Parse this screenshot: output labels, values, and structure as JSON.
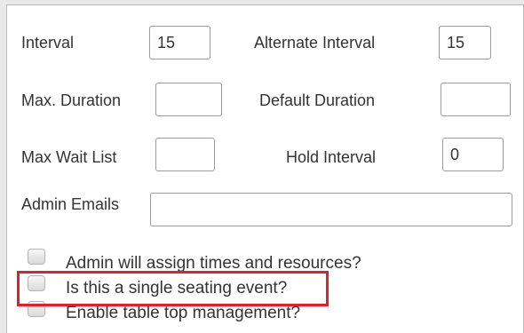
{
  "fields": {
    "interval": {
      "label": "Interval",
      "value": "15"
    },
    "alternate_interval": {
      "label": "Alternate Interval",
      "value": "15"
    },
    "max_duration": {
      "label": "Max. Duration",
      "value": ""
    },
    "default_duration": {
      "label": "Default Duration",
      "value": ""
    },
    "max_wait_list": {
      "label": "Max Wait List",
      "value": ""
    },
    "hold_interval": {
      "label": "Hold Interval",
      "value": "0"
    },
    "admin_emails": {
      "label": "Admin Emails",
      "value": ""
    }
  },
  "checkboxes": [
    {
      "label": "Admin will assign times and resources?",
      "checked": false
    },
    {
      "label": "Is this a single seating event?",
      "checked": false
    },
    {
      "label": "Enable table top management?",
      "checked": false
    }
  ],
  "colors": {
    "highlight": "#e2202b",
    "panel_border": "#b8b8b8",
    "input_border": "#9c9c9c"
  }
}
